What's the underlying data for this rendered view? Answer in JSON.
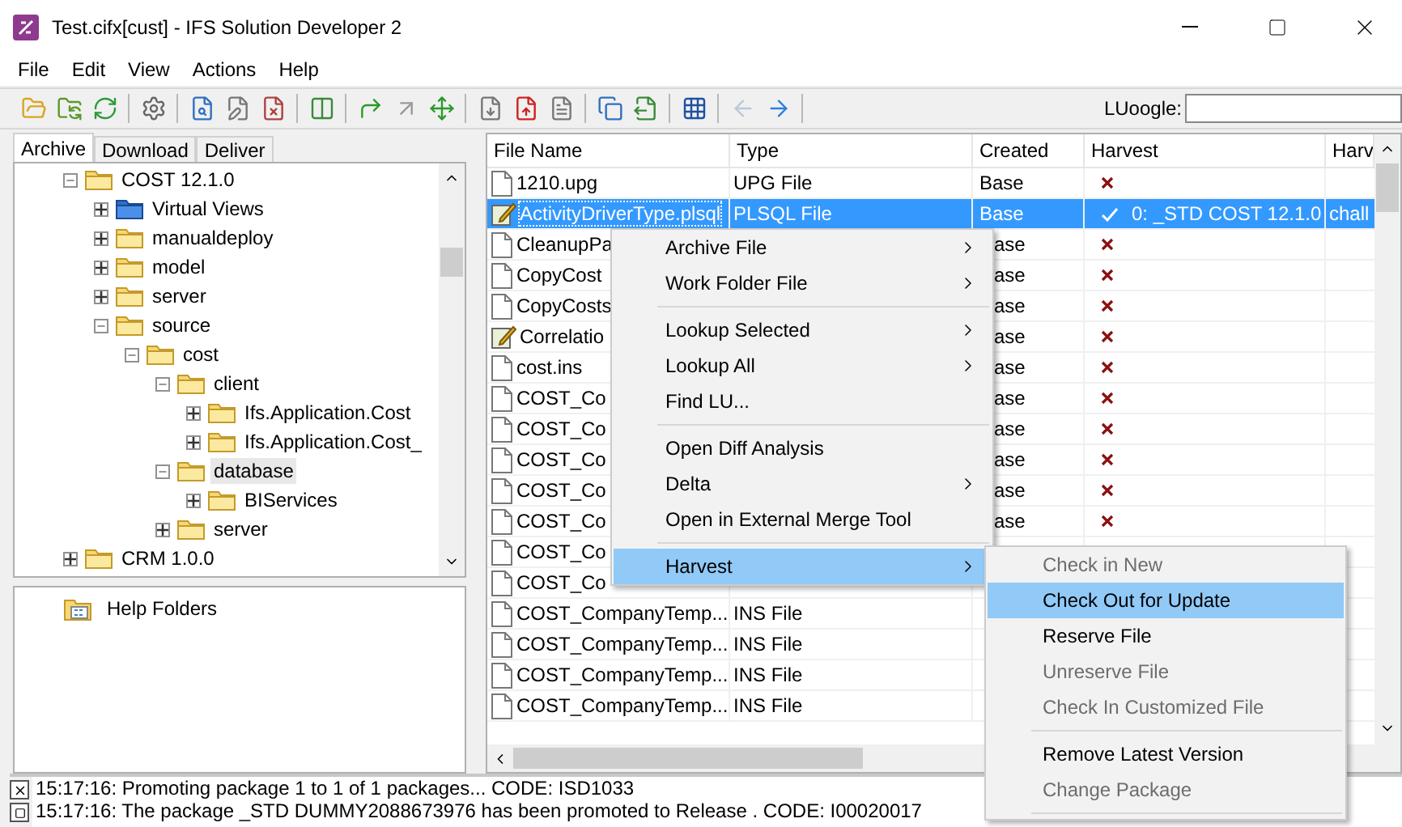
{
  "window": {
    "title": "Test.cifx[cust] - IFS Solution Developer 2"
  },
  "menu": [
    "File",
    "Edit",
    "View",
    "Actions",
    "Help"
  ],
  "toolbar": {
    "search_label": "LUoogle:"
  },
  "tabs": [
    {
      "label": "Archive",
      "selected": true
    },
    {
      "label": "Download",
      "selected": false
    },
    {
      "label": "Deliver",
      "selected": false
    }
  ],
  "tree": [
    {
      "label": "COST 12.1.0",
      "expanded": true,
      "selected": false,
      "children": [
        {
          "label": "Virtual Views",
          "kind": "virtual",
          "expanded": false,
          "selected": false
        },
        {
          "label": "manualdeploy",
          "expanded": false,
          "selected": false
        },
        {
          "label": "model",
          "expanded": false,
          "selected": false
        },
        {
          "label": "server",
          "expanded": false,
          "selected": false
        },
        {
          "label": "source",
          "expanded": true,
          "selected": false,
          "children": [
            {
              "label": "cost",
              "expanded": true,
              "selected": false,
              "children": [
                {
                  "label": "client",
                  "expanded": true,
                  "selected": false,
                  "children": [
                    {
                      "label": "Ifs.Application.Cost",
                      "expanded": false,
                      "selected": false
                    },
                    {
                      "label": "Ifs.Application.Cost_",
                      "expanded": false,
                      "selected": false
                    }
                  ]
                },
                {
                  "label": "database",
                  "expanded": true,
                  "selected": true,
                  "children": [
                    {
                      "label": "BIServices",
                      "expanded": false,
                      "selected": false
                    }
                  ]
                },
                {
                  "label": "server",
                  "expanded": false,
                  "selected": false
                }
              ]
            }
          ]
        }
      ]
    },
    {
      "label": "CRM 1.0.0",
      "expanded": false,
      "selected": false
    }
  ],
  "help_tree": [
    {
      "label": "Help Folders"
    }
  ],
  "table": {
    "columns": [
      "File Name",
      "Type",
      "Created",
      "Harvest",
      "Harv"
    ],
    "rows": [
      {
        "name": "1210.upg",
        "kind": "plain",
        "type": "UPG File",
        "created": "Base",
        "harvested": false,
        "selected": false
      },
      {
        "name": "ActivityDriverType.plsql",
        "kind": "edited",
        "type": "PLSQL File",
        "created": "Base",
        "harvested": true,
        "harvest_version": "0: _STD COST 12.1.0",
        "column_5": "chall",
        "selected": true
      },
      {
        "name": "CleanupPa",
        "kind": "plain",
        "created": "ase",
        "harvested": false,
        "selected": false
      },
      {
        "name": "CopyCost",
        "kind": "plain",
        "created": "ase",
        "harvested": false,
        "selected": false
      },
      {
        "name": "CopyCosts",
        "kind": "plain",
        "created": "ase",
        "harvested": false,
        "selected": false
      },
      {
        "name": "Correlatio",
        "kind": "edited",
        "created": "ase",
        "harvested": false,
        "selected": false
      },
      {
        "name": "cost.ins",
        "kind": "plain",
        "created": "ase",
        "harvested": false,
        "selected": false
      },
      {
        "name": "COST_Co",
        "kind": "plain",
        "created": "ase",
        "harvested": false,
        "selected": false
      },
      {
        "name": "COST_Co",
        "kind": "plain",
        "created": "ase",
        "harvested": false,
        "selected": false
      },
      {
        "name": "COST_Co",
        "kind": "plain",
        "created": "ase",
        "harvested": false,
        "selected": false
      },
      {
        "name": "COST_Co",
        "kind": "plain",
        "created": "ase",
        "harvested": false,
        "selected": false
      },
      {
        "name": "COST_Co",
        "kind": "plain",
        "created": "ase",
        "harvested": false,
        "selected": false
      },
      {
        "name": "COST_Co",
        "kind": "plain",
        "selected": false
      },
      {
        "name": "COST_Co",
        "kind": "plain",
        "selected": false
      },
      {
        "name": "COST_CompanyTemp...",
        "kind": "plain",
        "type": "INS File",
        "selected": false
      },
      {
        "name": "COST_CompanyTemp...",
        "kind": "plain",
        "type": "INS File",
        "selected": false
      },
      {
        "name": "COST_CompanyTemp...",
        "kind": "plain",
        "type": "INS File",
        "selected": false
      },
      {
        "name": "COST_CompanyTemp...",
        "kind": "plain",
        "type": "INS File",
        "selected": false
      }
    ]
  },
  "context_menu": [
    {
      "kind": "item",
      "label": "Archive File",
      "submenu": true,
      "disabled": false,
      "selected": false
    },
    {
      "kind": "item",
      "label": "Work Folder File",
      "submenu": true,
      "disabled": false,
      "selected": false
    },
    {
      "kind": "separator"
    },
    {
      "kind": "item",
      "label": "Lookup Selected",
      "submenu": true,
      "disabled": false,
      "selected": false
    },
    {
      "kind": "item",
      "label": "Lookup All",
      "submenu": true,
      "disabled": false,
      "selected": false
    },
    {
      "kind": "item",
      "label": "Find LU...",
      "submenu": false,
      "disabled": false,
      "selected": false
    },
    {
      "kind": "separator"
    },
    {
      "kind": "item",
      "label": "Open Diff Analysis",
      "submenu": false,
      "disabled": false,
      "selected": false
    },
    {
      "kind": "item",
      "label": "Delta",
      "submenu": true,
      "disabled": false,
      "selected": false
    },
    {
      "kind": "item",
      "label": "Open in External Merge Tool",
      "submenu": false,
      "disabled": false,
      "selected": false
    },
    {
      "kind": "separator"
    },
    {
      "kind": "item",
      "label": "Harvest",
      "submenu": true,
      "disabled": false,
      "selected": true
    }
  ],
  "submenu": [
    {
      "kind": "item",
      "label": "Check in New",
      "submenu": false,
      "disabled": true,
      "selected": false
    },
    {
      "kind": "item",
      "label": "Check Out for Update",
      "submenu": false,
      "disabled": false,
      "selected": true
    },
    {
      "kind": "item",
      "label": "Reserve File",
      "submenu": false,
      "disabled": false,
      "selected": false
    },
    {
      "kind": "item",
      "label": "Unreserve File",
      "submenu": false,
      "disabled": true,
      "selected": false
    },
    {
      "kind": "item",
      "label": "Check In Customized File",
      "submenu": false,
      "disabled": true,
      "selected": false
    },
    {
      "kind": "separator"
    },
    {
      "kind": "item",
      "label": "Remove Latest Version",
      "submenu": false,
      "disabled": false,
      "selected": false
    },
    {
      "kind": "item",
      "label": "Change Package",
      "submenu": false,
      "disabled": true,
      "selected": false
    },
    {
      "kind": "separator"
    }
  ],
  "log": [
    "15:17:16: Promoting package 1 to 1 of 1 packages... CODE: ISD1033",
    "15:17:16: The package _STD DUMMY2088673976  has been promoted to Release . CODE: I00020017"
  ]
}
